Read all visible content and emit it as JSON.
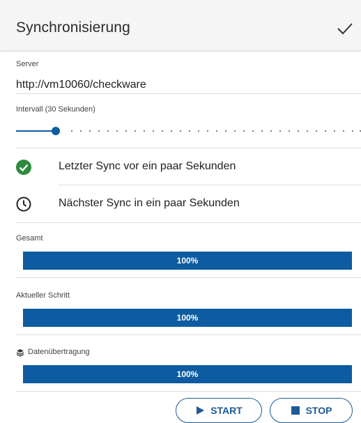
{
  "header": {
    "title": "Synchronisierung",
    "confirm_icon": "check-icon"
  },
  "server": {
    "label": "Server",
    "value": "http://vm10060/checkware"
  },
  "interval": {
    "label": "Intervall (30 Sekunden)",
    "slider_fraction": 0.12
  },
  "status": {
    "last_sync": {
      "icon": "check-circle-icon",
      "text": "Letzter Sync vor ein paar Sekunden",
      "color": "#2e8b3d"
    },
    "next_sync": {
      "icon": "clock-icon",
      "text": "Nächster Sync in ein paar Sekunden"
    }
  },
  "progress": {
    "total": {
      "label": "Gesamt",
      "value_text": "100%",
      "value": 1.0
    },
    "current_step": {
      "label": "Aktueller Schritt",
      "value_text": "100%",
      "value": 1.0
    },
    "data_transfer": {
      "label": "Datenübertragung",
      "icon": "layers-icon",
      "value_text": "100%",
      "value": 1.0
    }
  },
  "actions": {
    "start_label": "START",
    "stop_label": "STOP"
  },
  "colors": {
    "accent": "#0d5ba0",
    "success": "#2e8b3d"
  }
}
